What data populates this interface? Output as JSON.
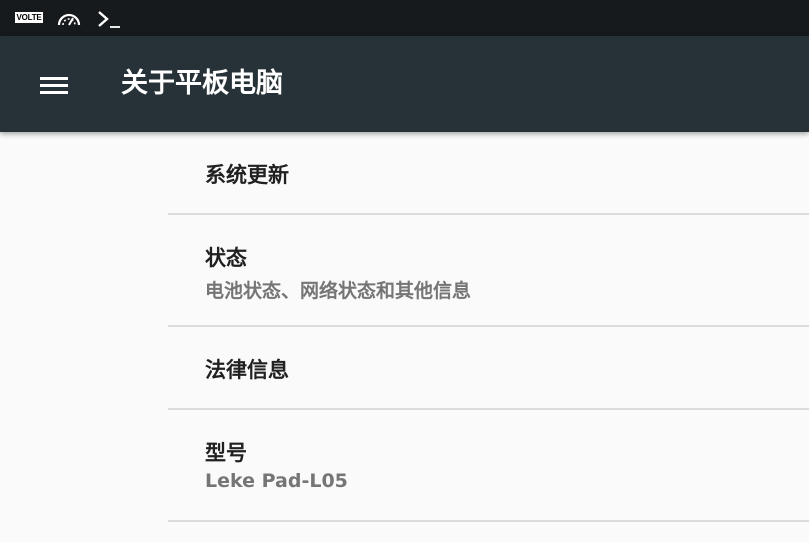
{
  "status_bar": {
    "volte_label": "VOLTE",
    "icons": [
      "volte-icon",
      "gauge-icon",
      "terminal-icon"
    ]
  },
  "app_bar": {
    "title": "关于平板电脑",
    "menu_icon": "menu-icon",
    "background": "#263238"
  },
  "prefs": [
    {
      "title": "系统更新"
    },
    {
      "title": "状态",
      "summary": "电池状态、网络状态和其他信息"
    },
    {
      "title": "法律信息"
    },
    {
      "title": "型号",
      "summary": "Leke Pad-L05"
    }
  ]
}
